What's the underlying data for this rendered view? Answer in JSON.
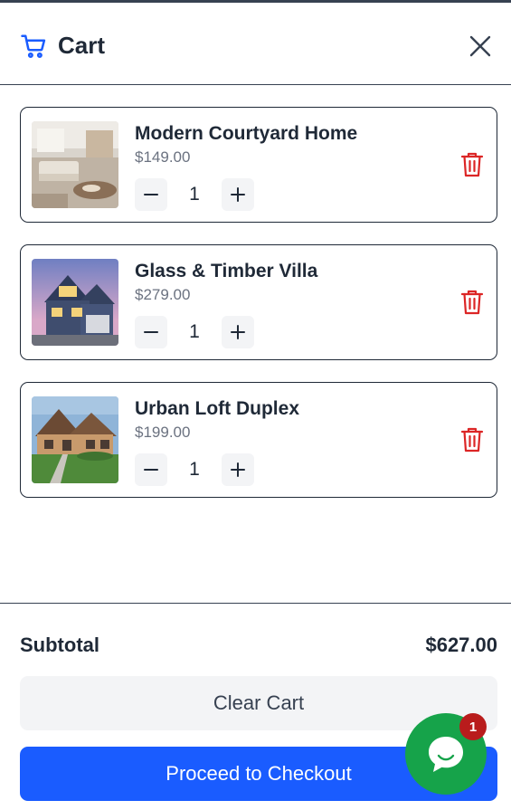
{
  "header": {
    "title": "Cart",
    "cart_icon": "cart-icon",
    "close_icon": "close-icon"
  },
  "items": [
    {
      "name": "Modern Courtyard Home",
      "price": "$149.00",
      "quantity": "1",
      "image": "interior-living-room"
    },
    {
      "name": "Glass & Timber Villa",
      "price": "$279.00",
      "quantity": "1",
      "image": "blue-house-dusk"
    },
    {
      "name": "Urban Loft Duplex",
      "price": "$199.00",
      "quantity": "1",
      "image": "stone-house-lawn"
    }
  ],
  "footer": {
    "subtotal_label": "Subtotal",
    "subtotal_value": "$627.00",
    "clear_label": "Clear Cart",
    "checkout_label": "Proceed to Checkout"
  },
  "chat": {
    "badge_count": "1",
    "icon": "chat-icon"
  },
  "colors": {
    "primary": "#1a5cff",
    "danger": "#dc2626",
    "chat": "#16a34a",
    "badge": "#b91c1c"
  }
}
